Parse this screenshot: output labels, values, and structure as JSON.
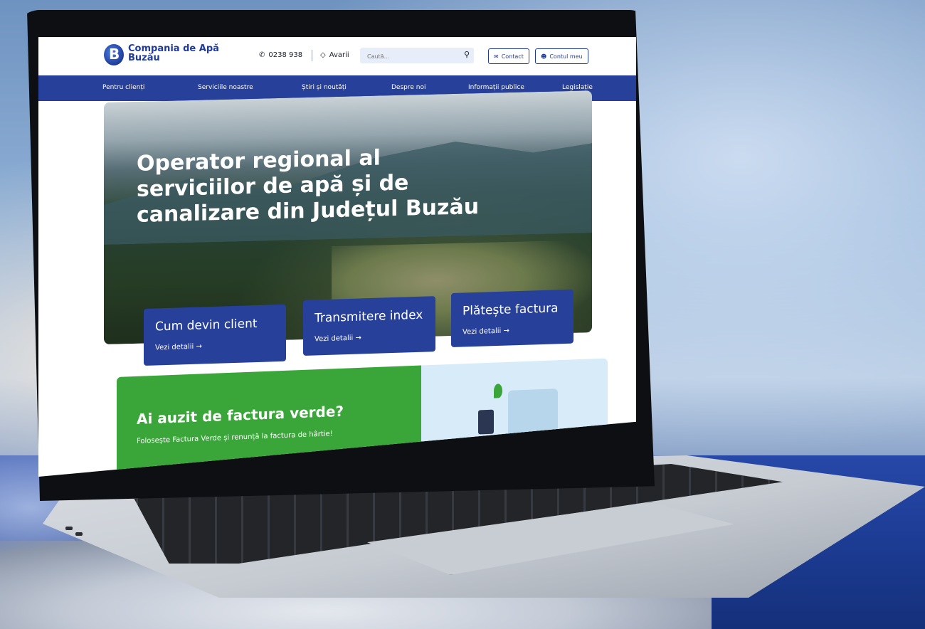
{
  "header": {
    "logo_line1": "Compania de Apă",
    "logo_line2": "Buzău",
    "logo_letter": "B",
    "phone": "0238 938",
    "avarii": "Avarii",
    "search_placeholder": "Caută...",
    "contact_label": "Contact",
    "account_label": "Contul meu"
  },
  "nav": {
    "items": [
      {
        "label": "Pentru clienți"
      },
      {
        "label": "Serviciile noastre"
      },
      {
        "label": "Știri și noutăți"
      },
      {
        "label": "Despre noi"
      },
      {
        "label": "Informații publice"
      },
      {
        "label": "Legislație"
      }
    ]
  },
  "hero": {
    "title": "Operator regional al serviciilor de apă și de canalizare din Județul Buzău"
  },
  "cards": [
    {
      "title": "Cum devin client",
      "link": "Vezi detalii →"
    },
    {
      "title": "Transmitere index",
      "link": "Vezi detalii →"
    },
    {
      "title": "Plătește factura",
      "link": "Vezi detalii →"
    }
  ],
  "banner": {
    "title": "Ai auzit de factura verde?",
    "subtitle": "Folosește Factura Verde și renunță la factura de hârtie!"
  },
  "colors": {
    "brand_blue": "#27409a",
    "green": "#3aa63a",
    "light_blue": "#d7ecf8"
  },
  "icons": {
    "phone": "phone-icon",
    "avarii": "diamond-alert-icon",
    "search": "search-icon",
    "contact": "mail-icon",
    "account": "user-circle-icon"
  }
}
